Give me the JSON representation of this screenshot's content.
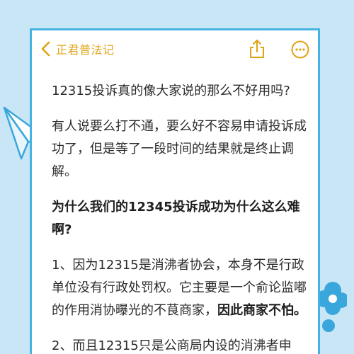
{
  "nav": {
    "back_label": "正君普法记",
    "back_icon": "chevron-left-icon",
    "share_icon": "share-icon",
    "more_icon": "more-icon",
    "accent_color": "#e0a314"
  },
  "article": {
    "question": "12315投诉真的像大家说的那么不好用吗?",
    "para1": "有人说要么打不通，要么好不容易申请投诉成功了，但是等了一段时间的结果就是终止调解。",
    "heading": "为什么我们的12345投诉成功为什么这么难啊?",
    "para2_normal": "1、因为12315是消沸者协会，本身不是行政单位没有行政处罚权。它主要是一个俞论监嘟的作用消协曝光的不茛商家，",
    "para2_bold": "因此商家不怕。",
    "para3": "2、而且12315只是公商局内设的消沸者申"
  },
  "theme": {
    "border_color": "#45b3e3",
    "background_color": "#c9e6f7"
  }
}
